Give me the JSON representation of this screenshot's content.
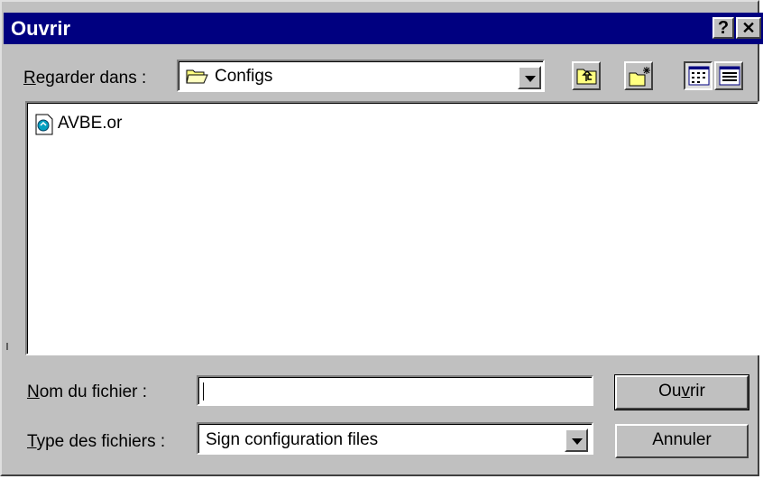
{
  "dialog": {
    "title": "Ouvrir",
    "help_button": "?",
    "close_button": "✕"
  },
  "look_in": {
    "label_mnemonic": "R",
    "label_rest": "egarder dans :",
    "value": "Configs",
    "value_icon": "folder-icon"
  },
  "toolbar": {
    "icons": [
      "up-one-level-icon",
      "new-folder-icon",
      "list-view-icon",
      "details-view-icon"
    ]
  },
  "files": [
    {
      "name": "AVBE.or",
      "icon": "config-file-icon"
    }
  ],
  "filename": {
    "label_mnemonic": "N",
    "label_rest": "om du fichier :",
    "value": ""
  },
  "filetype": {
    "label_mnemonic": "T",
    "label_rest": "ype des fichiers :",
    "value": "Sign configuration files"
  },
  "buttons": {
    "open_pre": "Ou",
    "open_mnemonic": "v",
    "open_post": "rir",
    "cancel": "Annuler"
  },
  "colors": {
    "titlebar": "#000080",
    "dialog_face": "#c0c0c0",
    "title_text": "#ffffff"
  }
}
